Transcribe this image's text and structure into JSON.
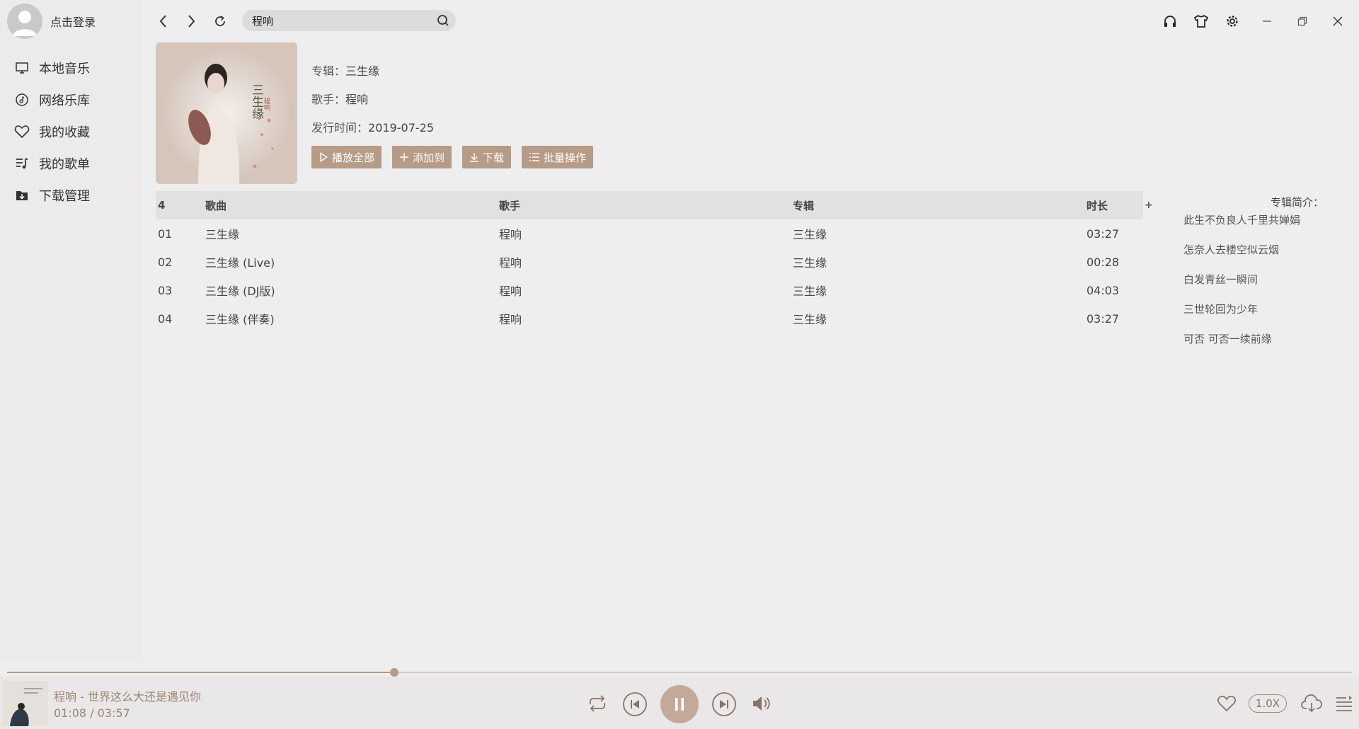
{
  "sidebar": {
    "login_text": "点击登录",
    "items": [
      {
        "label": "本地音乐",
        "icon": "monitor-icon"
      },
      {
        "label": "网络乐库",
        "icon": "music-disc-icon"
      },
      {
        "label": "我的收藏",
        "icon": "heart-icon"
      },
      {
        "label": "我的歌单",
        "icon": "playlist-icon"
      },
      {
        "label": "下载管理",
        "icon": "download-folder-icon"
      }
    ]
  },
  "search": {
    "value": "程响",
    "placeholder": ""
  },
  "album": {
    "album_label": "专辑：",
    "album_name": "三生缘",
    "artist_label": "歌手：",
    "artist_name": "程响",
    "release_label": "发行时间：",
    "release_date": "2019-07-25",
    "cover_text": "三生缘",
    "cover_subtext": "程响"
  },
  "actions": {
    "play_all": "播放全部",
    "add_to": "添加到",
    "download": "下载",
    "batch": "批量操作"
  },
  "table": {
    "headers": {
      "count": "4",
      "title": "歌曲",
      "artist": "歌手",
      "album": "专辑",
      "duration": "时长"
    },
    "plus": "+",
    "rows": [
      {
        "idx": "01",
        "title": "三生缘",
        "artist": "程响",
        "album": "三生缘",
        "duration": "03:27"
      },
      {
        "idx": "02",
        "title": "三生缘 (Live)",
        "artist": "程响",
        "album": "三生缘",
        "duration": "00:28"
      },
      {
        "idx": "03",
        "title": "三生缘 (DJ版)",
        "artist": "程响",
        "album": "三生缘",
        "duration": "04:03"
      },
      {
        "idx": "04",
        "title": "三生缘 (伴奏)",
        "artist": "程响",
        "album": "三生缘",
        "duration": "03:27"
      }
    ]
  },
  "intro": {
    "title": "专辑简介：",
    "lines": [
      "此生不负良人千里共婵娟",
      "怎奈人去楼空似云烟",
      "白发青丝一瞬间",
      "三世轮回为少年",
      "可否 可否一续前缘"
    ]
  },
  "player": {
    "now_playing": "程响 - 世界这么大还是遇见你",
    "time": "01:08 / 03:57",
    "progress": 0.288,
    "speed": "1.0X",
    "accent": "#b69b86"
  }
}
